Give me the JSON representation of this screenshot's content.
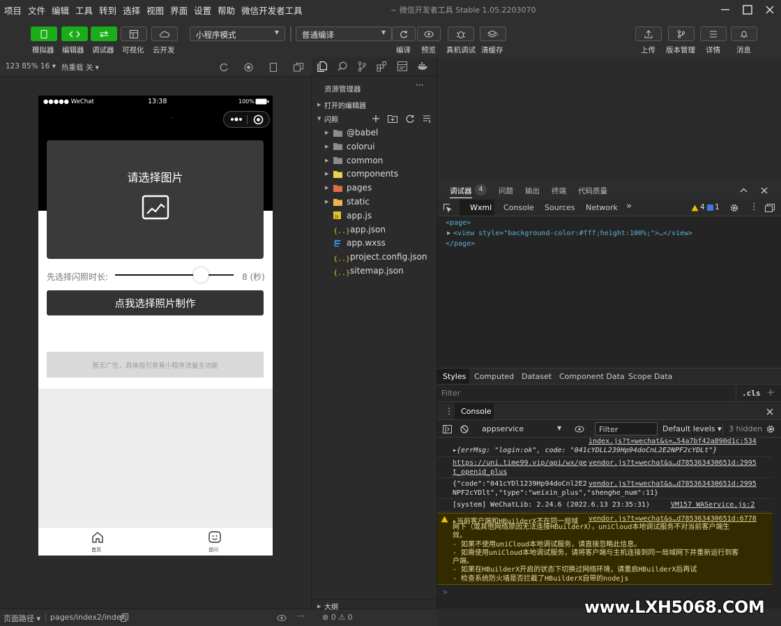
{
  "menu": [
    "项目",
    "文件",
    "编辑",
    "工具",
    "转到",
    "选择",
    "视图",
    "界面",
    "设置",
    "帮助",
    "微信开发者工具"
  ],
  "title": "~ 微信开发者工具 Stable 1.05.2203070",
  "toolbar": {
    "left_buttons": [
      "模拟器",
      "编辑器",
      "调试器",
      "可视化",
      "云开发"
    ],
    "mode": "小程序模式",
    "compile": "普通编译",
    "mid_buttons": [
      "编译",
      "预览",
      "真机调试",
      "清缓存"
    ],
    "right_buttons": [
      "上传",
      "版本管理",
      "详情",
      "消息"
    ]
  },
  "sim": {
    "zoom": "123 85% 16 ▾",
    "hot_reload": "热重载 关 ▾",
    "status_left": "●●●●● WeChat",
    "time": "13:38",
    "battery": "100%",
    "nav_title": "·",
    "pick_text": "请选择图片",
    "slider_label": "先选择闪照时长:",
    "slider_value": "8 (秒)",
    "slider_level": 0.75,
    "make_button": "点我选择照片制作",
    "ad_text": "暂无广告，具体指引查看小程序流量主功能",
    "tabs": [
      "首页",
      "提问"
    ]
  },
  "statusbar": {
    "path_label": "页面路径 ▾",
    "path": "pages/index2/index"
  },
  "explorer": {
    "title": "资源管理器",
    "open_editors": "打开的编辑器",
    "project": "闪照",
    "items": [
      {
        "name": "@babel",
        "type": "folder"
      },
      {
        "name": "colorui",
        "type": "folder"
      },
      {
        "name": "common",
        "type": "folder"
      },
      {
        "name": "components",
        "type": "folder"
      },
      {
        "name": "pages",
        "type": "folder"
      },
      {
        "name": "static",
        "type": "folder"
      },
      {
        "name": "app.js",
        "type": "js"
      },
      {
        "name": "app.json",
        "type": "json"
      },
      {
        "name": "app.wxss",
        "type": "wxss"
      },
      {
        "name": "project.config.json",
        "type": "json"
      },
      {
        "name": "sitemap.json",
        "type": "json"
      }
    ],
    "outline": "大纲",
    "problems": "⊗ 0 ⚠ 0"
  },
  "devtools": {
    "top_tabs": [
      "调试器",
      "问题",
      "输出",
      "终端",
      "代码质量"
    ],
    "badge": "4",
    "panel_tabs": [
      "Wxml",
      "Console",
      "Sources",
      "Network"
    ],
    "warn_count": "4",
    "info_count": "1",
    "wxml": [
      "<page>",
      "<view style=\"background-color:#fff;height:100%;\">…</view>",
      "</page>"
    ],
    "style_tabs": [
      "Styles",
      "Computed",
      "Dataset",
      "Component Data",
      "Scope Data"
    ],
    "filter": "Filter",
    "cls": ".cls",
    "console_tab": "Console",
    "context": "appservice",
    "filter2": "Filter",
    "levels": "Default levels ▾",
    "hidden": "3 hidden",
    "logs": {
      "l1_src": "index.js?t=wechat&s=…54a7bf42a890d1c:534",
      "l1_text": "▸{errMsg: \"login:ok\", code: \"041cYDLL239Hp94doCnL2E2NPF2cYDLt\"}",
      "l2_a": "https://uni.time99.vip/api/wx/ge",
      "l2_b": "t_openid_plus",
      "l2_src": "vendor.js?t=wechat&s…d785363430651d:2995",
      "l3_a": "{\"code\":\"041cYDl1239Hp94doCnl2E2",
      "l3_b": "NPF2cYDlt\",\"type\":\"weixin_plus\",\"shenghe_num\":11}",
      "l3_src": "vendor.js?t=wechat&s…d785363430651d:2995",
      "l4_text": "[system] WeChatLib: 2.24.6 (2022.6.13 23:35:31)",
      "l4_src": "VM157 WAService.js:2",
      "warn_head": "▸当前客户端和HBuilderX不在同一局域",
      "warn_src": "vendor.js?t=wechat&s…d785363430651d:6778",
      "warn_lines": [
        "网下（或其他网络原因无法连接HBuilderX），uniCloud本地调试服务不对当前客户端生",
        "效。",
        "- 如果不使用uniCloud本地调试服务，请直接忽略此信息。",
        "- 如需使用uniCloud本地调试服务，请将客户端与主机连接到同一局域网下并重新运行到客",
        "户端。",
        "- 如果在HBuilderX开启的状态下切换过网络环境，请重启HBuilderX后再试",
        "- 检查系统防火墙是否拦截了HBuilderX自带的nodejs"
      ],
      "prompt": ">"
    }
  },
  "watermark": "www.LXH5068.COM",
  "colors": {
    "green": "#1aad19",
    "bg": "#2b2b2b",
    "warn_bg": "#332b00"
  }
}
